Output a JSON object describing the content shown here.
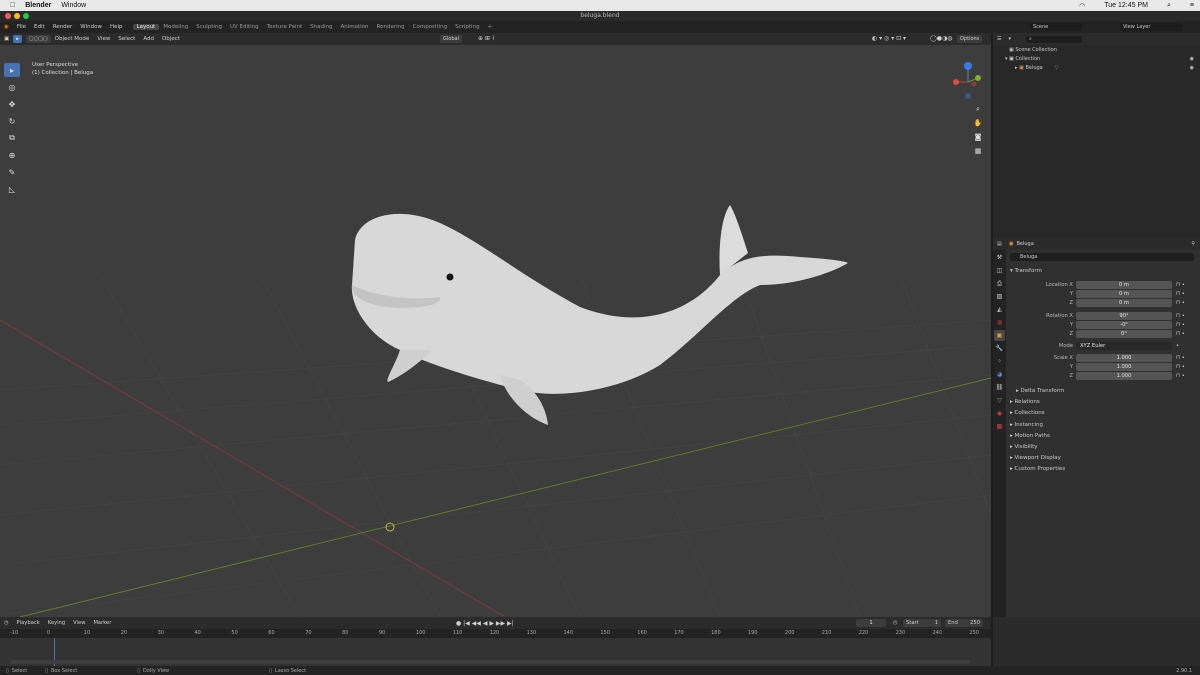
{
  "mac_menu": {
    "app": "Blender",
    "window": "Window",
    "time": "Tue 12:45 PM"
  },
  "window_title": "beluga.blend",
  "top_menu": [
    "File",
    "Edit",
    "Render",
    "Window",
    "Help"
  ],
  "workspaces": [
    "Layout",
    "Modeling",
    "Sculpting",
    "UV Editing",
    "Texture Paint",
    "Shading",
    "Animation",
    "Rendering",
    "Compositing",
    "Scripting",
    "+"
  ],
  "scene": {
    "label": "Scene",
    "view_layer": "View Layer"
  },
  "vp_header": {
    "mode": "Object Mode",
    "menus": [
      "View",
      "Select",
      "Add",
      "Object"
    ],
    "orientation": "Global",
    "options": "Options"
  },
  "vp_info": {
    "line1": "User Perspective",
    "line2": "(1) Collection | Beluga"
  },
  "outliner": {
    "scene_collection": "Scene Collection",
    "collection": "Collection",
    "object": "Beluga"
  },
  "properties": {
    "object_name": "Beluga",
    "transform": "Transform",
    "location": {
      "x_label": "Location X",
      "y_label": "Y",
      "z_label": "Z",
      "x": "0 m",
      "y": "0 m",
      "z": "0 m"
    },
    "rotation": {
      "x_label": "Rotation X",
      "y_label": "Y",
      "z_label": "Z",
      "x": "90°",
      "y": "-0°",
      "z": "0°"
    },
    "mode": {
      "label": "Mode",
      "value": "XYZ Euler"
    },
    "scale": {
      "x_label": "Scale X",
      "y_label": "Y",
      "z_label": "Z",
      "x": "1.000",
      "y": "1.000",
      "z": "1.000"
    },
    "panels": [
      "Delta Transform",
      "Relations",
      "Collections",
      "Instancing",
      "Motion Paths",
      "Visibility",
      "Viewport Display",
      "Custom Properties"
    ]
  },
  "timeline": {
    "menus": [
      "Playback",
      "Keying",
      "View",
      "Marker"
    ],
    "current": "1",
    "start_label": "Start",
    "start": "1",
    "end_label": "End",
    "end": "250",
    "ticks": [
      "-10",
      "0",
      "10",
      "20",
      "30",
      "40",
      "50",
      "60",
      "70",
      "80",
      "90",
      "100",
      "110",
      "120",
      "130",
      "140",
      "150",
      "160",
      "170",
      "180",
      "190",
      "200",
      "210",
      "220",
      "230",
      "240",
      "250"
    ]
  },
  "status": {
    "select": "Select",
    "box": "Box Select",
    "dolly": "Dolly View",
    "lasso": "Lasso Select",
    "version": "2.90.1"
  }
}
